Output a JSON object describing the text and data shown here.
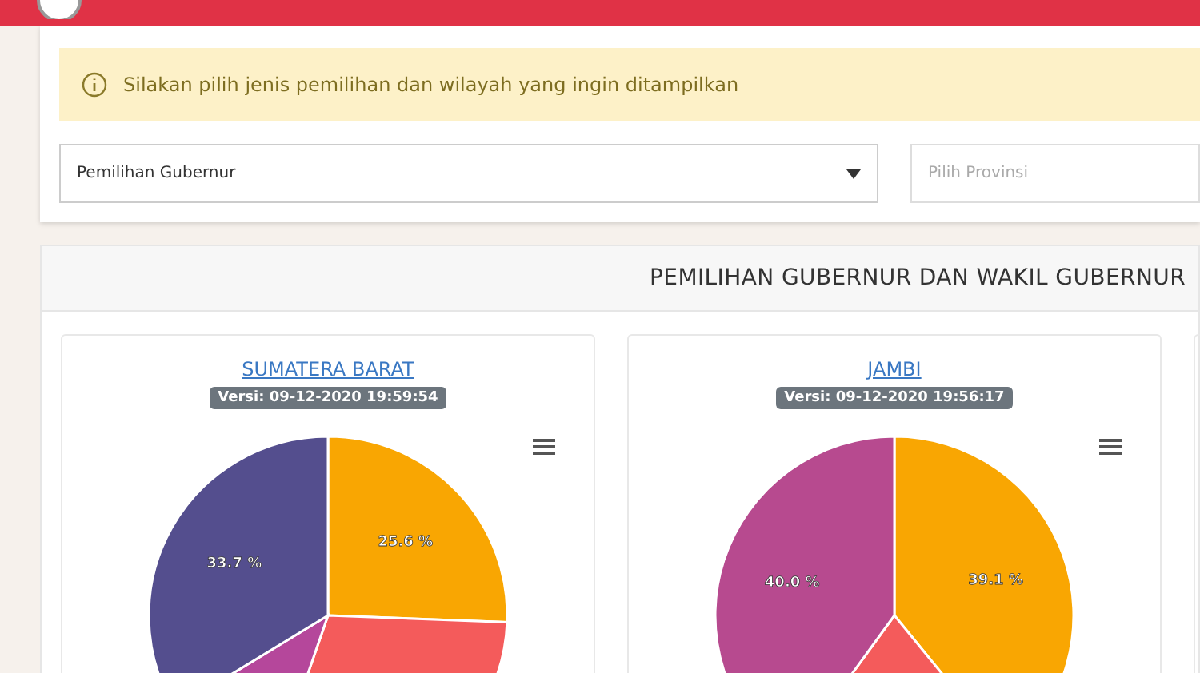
{
  "alert": {
    "text": "Silakan pilih jenis pemilihan dan wilayah yang ingin ditampilkan"
  },
  "filters": [
    {
      "kind": "select",
      "value": "Pemilihan Gubernur"
    },
    {
      "kind": "input",
      "placeholder": "Pilih Provinsi"
    }
  ],
  "panel": {
    "title": "PEMILIHAN GUBERNUR DAN WAKIL GUBERNUR",
    "cards": [
      {
        "region": "SUMATERA BARAT",
        "version": "Versi: 09-12-2020 19:59:54",
        "chart_data": {
          "type": "pie",
          "values": [
            25.6,
            29.7,
            11.0,
            33.7
          ],
          "colors": [
            "#f9a602",
            "#f45b5b",
            "#b5479b",
            "#544e8e"
          ],
          "value_labels": [
            "25.6 %",
            null,
            null,
            "33.7 %"
          ]
        }
      },
      {
        "region": "JAMBI",
        "version": "Versi: 09-12-2020 19:56:17",
        "chart_data": {
          "type": "pie",
          "values": [
            39.1,
            20.9,
            40.0
          ],
          "colors": [
            "#f9a602",
            "#f45b5b",
            "#b74a8f"
          ],
          "value_labels": [
            "39.1 %",
            null,
            "40.0 %"
          ]
        }
      }
    ]
  }
}
